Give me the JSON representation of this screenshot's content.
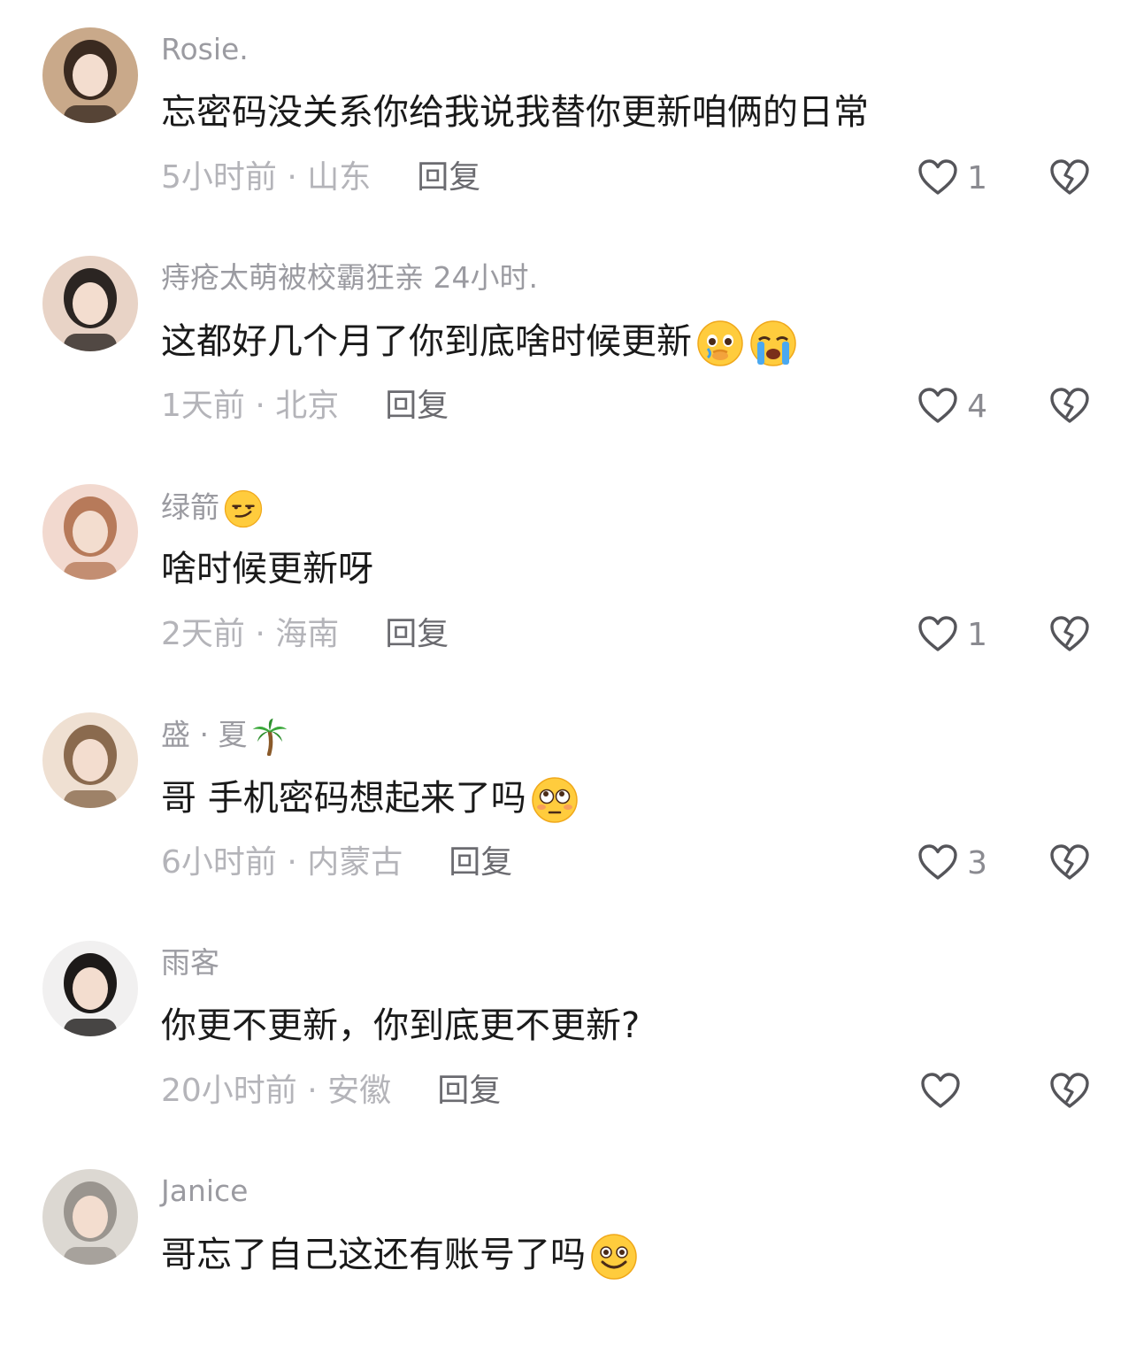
{
  "comments": [
    {
      "username": "Rosie.",
      "username_emoji": "",
      "content": "忘密码没关系你给我说我替你更新咱俩的日常",
      "content_emojis": [],
      "time": "5小时前",
      "separator": "·",
      "region": "山东",
      "reply_label": "回复",
      "likes": "1",
      "avatar_colors": [
        "#3a2a20",
        "#c9a98a"
      ]
    },
    {
      "username": "痔疮太萌被校霸狂亲 24小时.",
      "username_emoji": "",
      "content": "这都好几个月了你到底啥时候更新",
      "content_emojis": [
        "pleading-face-emoji",
        "loudly-crying-face-emoji"
      ],
      "time": "1天前",
      "separator": "·",
      "region": "北京",
      "reply_label": "回复",
      "likes": "4",
      "avatar_colors": [
        "#2b2522",
        "#e8d3c6"
      ]
    },
    {
      "username": "绿箭",
      "username_emoji": "smirking-face-emoji",
      "content": "啥时候更新呀",
      "content_emojis": [],
      "time": "2天前",
      "separator": "·",
      "region": "海南",
      "reply_label": "回复",
      "likes": "1",
      "avatar_colors": [
        "#b77a5a",
        "#f2d9cf"
      ]
    },
    {
      "username": "盛 · 夏",
      "username_emoji": "palm-tree-emoji",
      "content": "哥 手机密码想起来了吗",
      "content_emojis": [
        "flushed-face-emoji"
      ],
      "time": "6小时前",
      "separator": "·",
      "region": "内蒙古",
      "reply_label": "回复",
      "likes": "3",
      "avatar_colors": [
        "#8a6a4e",
        "#efe0d2"
      ]
    },
    {
      "username": "雨客",
      "username_emoji": "",
      "content": "你更不更新，你到底更不更新?",
      "content_emojis": [],
      "time": "20小时前",
      "separator": "·",
      "region": "安徽",
      "reply_label": "回复",
      "likes": "",
      "avatar_colors": [
        "#1d1a19",
        "#f1f0f0"
      ]
    },
    {
      "username": "Janice",
      "username_emoji": "",
      "content": "哥忘了自己这还有账号了吗",
      "content_emojis": [
        "grinning-face-emoji"
      ],
      "time": "",
      "separator": "",
      "region": "",
      "reply_label": "",
      "likes": "",
      "avatar_colors": [
        "#9a958f",
        "#dcd8d2"
      ]
    }
  ],
  "colors": {
    "username": "#9b9ba1",
    "content": "#1a1a1a",
    "meta": "#b4b4b9",
    "reply": "#6b6b70",
    "icon": "#55555a"
  }
}
